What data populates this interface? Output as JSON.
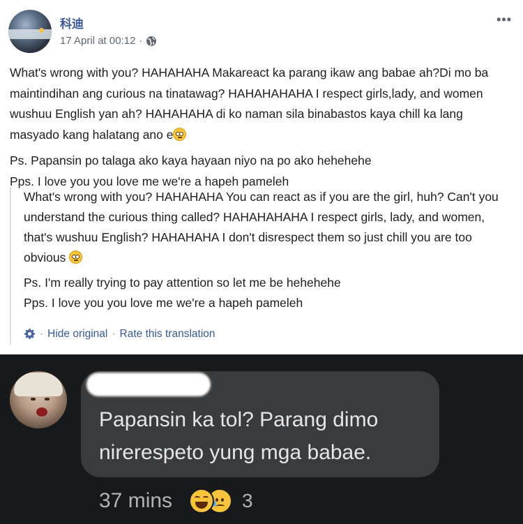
{
  "post": {
    "author": "科迪",
    "timestamp": "17 April at 00:12",
    "meta_separator": "·",
    "more_icon": "more-icon",
    "privacy_icon": "globe-icon",
    "paragraphs": [
      "What's wrong with you? HAHAHAHA Makareact ka parang ikaw ang babae ah?Di mo ba maintindihan ang curious na tinatawag? HAHAHAHAHA I respect girls,lady, and women wushuu English yan ah? HAHAHAHA di ko naman sila binabastos kaya chill ka lang masyado kang halatang ano e",
      "Ps. Papansin po talaga ako kaya hayaan niyo na po ako hehehehe",
      "Pps. I love you you love me we're a hapeh pameleh"
    ],
    "translation": {
      "paragraphs": [
        "What's wrong with you? HAHAHAHA You can react as if you are the girl, huh? Can't you understand the curious thing called? HAHAHAHAHA I respect girls, lady, and women, that's wushuu English? HAHAHAHA I don't disrespect them so just chill you are too obvious",
        "Ps. I'm really trying to pay attention so let me be hehehehe",
        "Pps. I love you you love me we're a hapeh pameleh"
      ],
      "hide_original": "Hide original",
      "separator": "·",
      "rate_translation": "Rate this translation"
    }
  },
  "comment": {
    "text": "Papansin ka tol? Parang dimo nirerespeto yung mga babae.",
    "time": "37 mins",
    "reactions": [
      "laughing",
      "sad"
    ],
    "reaction_count": "3"
  },
  "colors": {
    "link": "#385898",
    "dark_bg": "#18191a",
    "bubble_bg": "#3a3b3c",
    "dark_text": "#e4e6eb",
    "dark_secondary": "#b0b3b8"
  }
}
